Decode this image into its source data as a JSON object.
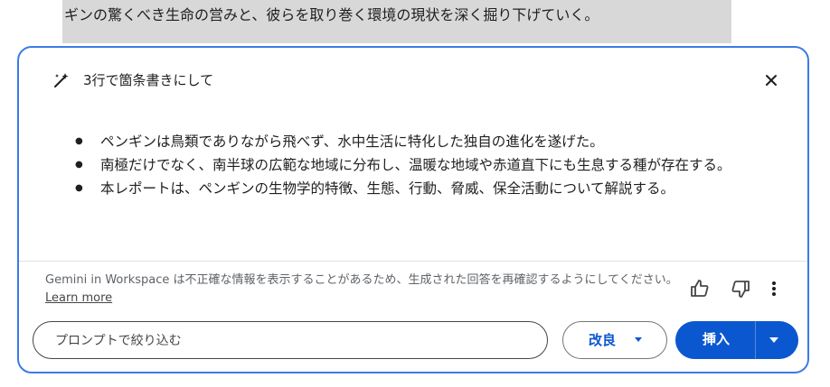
{
  "document": {
    "visible_line": "ギンの驚くべき生命の営みと、彼らを取り巻く環境の現状を深く掘り下げていく。"
  },
  "panel": {
    "title": "3行で箇条書きにして",
    "bullets": [
      "ペンギンは鳥類でありながら飛べず、水中生活に特化した独自の進化を遂げた。",
      "南極だけでなく、南半球の広範な地域に分布し、温暖な地域や赤道直下にも生息する種が存在する。",
      "本レポートは、ペンギンの生物学的特徴、生態、行動、脅威、保全活動について解説する。"
    ],
    "disclaimer": "Gemini in Workspace は不正確な情報を表示することがあるため、生成された回答を再確認するようにしてください。",
    "learn_more": "Learn more",
    "prompt_placeholder": "プロンプトで絞り込む",
    "refine_label": "改良",
    "insert_label": "挿入",
    "icons": {
      "wand": "magic-wand-icon",
      "close": "close-icon",
      "thumb_up": "thumb-up-icon",
      "thumb_down": "thumb-down-icon",
      "more": "more-vert-icon",
      "caret": "caret-down-icon"
    },
    "colors": {
      "accent": "#0b57d0",
      "border": "#3b7be8",
      "doc_highlight": "#d8d8d8"
    }
  }
}
